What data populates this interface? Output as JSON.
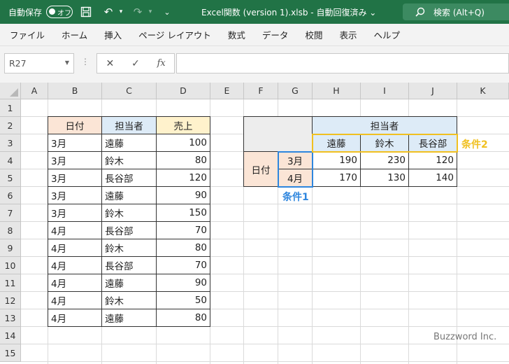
{
  "titlebar": {
    "autosave_label": "自動保存",
    "autosave_state": "オフ",
    "file_title": "Excel関数 (version 1).xlsb  -  自動回復済み  ⌄",
    "search_label": "検索 (Alt+Q)"
  },
  "menu": [
    "ファイル",
    "ホーム",
    "挿入",
    "ページ レイアウト",
    "数式",
    "データ",
    "校閲",
    "表示",
    "ヘルプ"
  ],
  "formula_bar": {
    "name_box": "R27",
    "formula": ""
  },
  "columns": [
    "A",
    "B",
    "C",
    "D",
    "E",
    "F",
    "G",
    "H",
    "I",
    "J",
    "K"
  ],
  "rows": [
    "1",
    "2",
    "3",
    "4",
    "5",
    "6",
    "7",
    "8",
    "9",
    "10",
    "11",
    "12",
    "13",
    "14",
    "15"
  ],
  "source_table": {
    "headers": [
      "日付",
      "担当者",
      "売上"
    ],
    "rows": [
      [
        "3月",
        "遠藤",
        "100"
      ],
      [
        "3月",
        "鈴木",
        "80"
      ],
      [
        "3月",
        "長谷部",
        "120"
      ],
      [
        "3月",
        "遠藤",
        "90"
      ],
      [
        "3月",
        "鈴木",
        "150"
      ],
      [
        "4月",
        "長谷部",
        "70"
      ],
      [
        "4月",
        "鈴木",
        "80"
      ],
      [
        "4月",
        "長谷部",
        "70"
      ],
      [
        "4月",
        "遠藤",
        "90"
      ],
      [
        "4月",
        "鈴木",
        "50"
      ],
      [
        "4月",
        "遠藤",
        "80"
      ]
    ]
  },
  "cross_table": {
    "col_group_label": "担当者",
    "row_group_label": "日付",
    "col_headers": [
      "遠藤",
      "鈴木",
      "長谷部"
    ],
    "row_headers": [
      "3月",
      "4月"
    ],
    "values": [
      [
        "190",
        "230",
        "120"
      ],
      [
        "170",
        "130",
        "140"
      ]
    ]
  },
  "annotations": {
    "cond1": "条件1",
    "cond2": "条件2",
    "cond1_color": "#2e86de",
    "cond2_color": "#f0c020"
  },
  "watermark": "Buzzword Inc."
}
